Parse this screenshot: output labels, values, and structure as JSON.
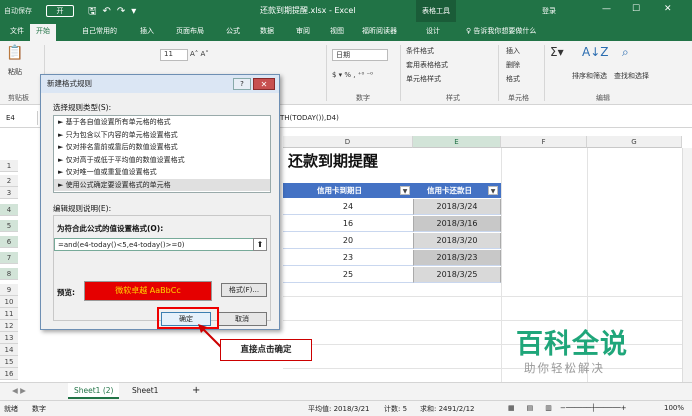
{
  "titlebar": {
    "autosave": "自动保存",
    "toggle": "开",
    "doc_title": "还款到期提醒.xlsx - Excel",
    "table_tools": "表格工具",
    "login": "登录"
  },
  "ribbon_tabs": [
    "文件",
    "开始",
    "自己常用的",
    "插入",
    "页面布局",
    "公式",
    "数据",
    "审阅",
    "视图",
    "福昕阅读器",
    "设计",
    "♀ 告诉我你想要做什么"
  ],
  "ribbon": {
    "paste": "粘贴",
    "clipboard": "剪贴板",
    "font_size": "11",
    "number_format": "日期",
    "number_group": "数字",
    "cond_format": "条件格式",
    "table_format": "套用表格格式",
    "cell_styles": "单元格样式",
    "styles_group": "样式",
    "insert": "插入",
    "delete": "删除",
    "format": "格式",
    "cells_group": "单元格",
    "sort_filter": "排序和筛选",
    "find_select": "查找和选择",
    "edit_group": "编辑"
  },
  "formula_bar": {
    "name_box": "E4",
    "formula": "TH(TODAY()),D4)"
  },
  "grid": {
    "columns": [
      "D",
      "E",
      "F",
      "G"
    ],
    "rows": [
      "1",
      "2",
      "3",
      "4",
      "5",
      "6",
      "7",
      "8",
      "9",
      "10",
      "11",
      "12",
      "13",
      "14",
      "15",
      "16"
    ],
    "title": "还款到期提醒",
    "headers": {
      "d": "信用卡到期日",
      "e": "信用卡还款日"
    },
    "data": [
      {
        "d": "24",
        "e": "2018/3/24"
      },
      {
        "d": "16",
        "e": "2018/3/16"
      },
      {
        "d": "20",
        "e": "2018/3/20"
      },
      {
        "d": "23",
        "e": "2018/3/23"
      },
      {
        "d": "25",
        "e": "2018/3/25"
      }
    ]
  },
  "sheets": {
    "sheet1_2": "Sheet1 (2)",
    "sheet1": "Sheet1",
    "add": "+"
  },
  "status": {
    "ready": "就绪",
    "numbers": "数字",
    "avg": "平均值: 2018/3/21",
    "count": "计数: 5",
    "sum": "求和: 2491/2/12",
    "zoom": "100%"
  },
  "dialog": {
    "title": "新建格式规则",
    "help": "?",
    "close": "✕",
    "select_type_label": "选择规则类型(S):",
    "rule_types": [
      "► 基于各自值设置所有单元格的格式",
      "► 只为包含以下内容的单元格设置格式",
      "► 仅对排名靠前或靠后的数值设置格式",
      "► 仅对高于或低于平均值的数值设置格式",
      "► 仅对唯一值或重复值设置格式",
      "► 使用公式确定要设置格式的单元格"
    ],
    "edit_desc_label": "编辑规则说明(E):",
    "formula_label": "为符合此公式的值设置格式(O):",
    "formula_value": "=and(e4-today()<5,e4-today()>=0)",
    "preview_label": "预览:",
    "preview_text": "微软卓越  AaBbCc",
    "format_button": "格式(F)...",
    "ok_button": "确定",
    "cancel_button": "取消"
  },
  "callout": "直接点击确定",
  "watermark": {
    "logo": "百科全说",
    "sub": "助你轻松解决"
  },
  "colors": {
    "excel_green": "#217346",
    "table_header": "#4472c4",
    "preview_bg": "#e50000",
    "highlight": "#e00000"
  }
}
